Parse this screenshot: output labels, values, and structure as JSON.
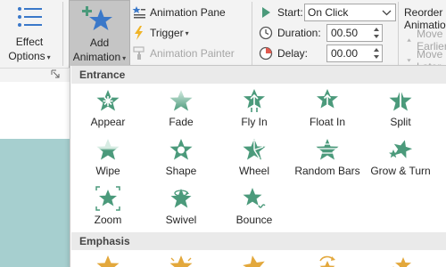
{
  "ribbon": {
    "effect_options": {
      "line1": "Effect",
      "line2": "Options",
      "icon": "effect-options-icon"
    },
    "add_animation": {
      "line1": "Add",
      "line2": "Animation",
      "icon": "add-animation-star-icon"
    },
    "animation_pane": "Animation Pane",
    "trigger": "Trigger",
    "animation_painter": "Animation Painter",
    "start_label": "Start:",
    "start_value": "On Click",
    "duration_label": "Duration:",
    "duration_value": "00.50",
    "delay_label": "Delay:",
    "delay_value": "00.00",
    "reorder_title": "Reorder Animation",
    "move_earlier": "Move Earlier",
    "move_later": "Move Later"
  },
  "gallery": {
    "entrance_header": "Entrance",
    "emphasis_header": "Emphasis",
    "entrance": [
      {
        "label": "Appear",
        "icon": "appear-icon"
      },
      {
        "label": "Fade",
        "icon": "fade-icon"
      },
      {
        "label": "Fly In",
        "icon": "fly-in-icon"
      },
      {
        "label": "Float In",
        "icon": "float-in-icon"
      },
      {
        "label": "Split",
        "icon": "split-icon"
      },
      {
        "label": "Wipe",
        "icon": "wipe-icon"
      },
      {
        "label": "Shape",
        "icon": "shape-icon"
      },
      {
        "label": "Wheel",
        "icon": "wheel-icon"
      },
      {
        "label": "Random Bars",
        "icon": "random-bars-icon"
      },
      {
        "label": "Grow & Turn",
        "icon": "grow-and-turn-icon"
      },
      {
        "label": "Zoom",
        "icon": "zoom-icon"
      },
      {
        "label": "Swivel",
        "icon": "swivel-icon"
      },
      {
        "label": "Bounce",
        "icon": "bounce-icon"
      }
    ]
  },
  "colors": {
    "entrance_star": "#4b9a7b",
    "emphasis_star": "#e3a83c",
    "accent_blue": "#3a78c9",
    "slide_bg": "#a6cfcf"
  }
}
